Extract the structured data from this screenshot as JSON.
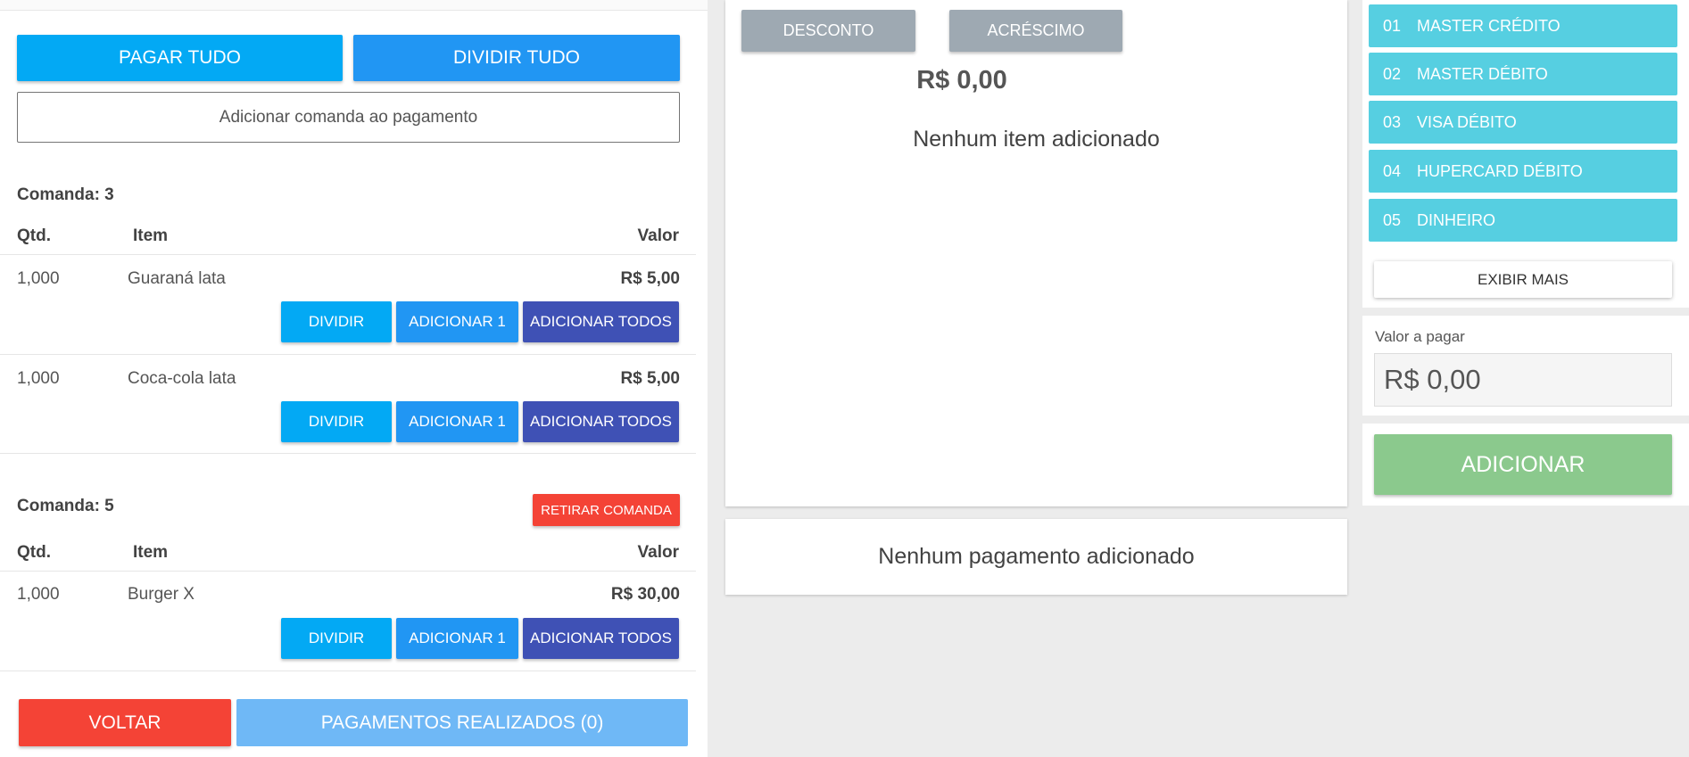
{
  "left": {
    "pay_all": "PAGAR TUDO",
    "split_all": "DIVIDIR TUDO",
    "add_comanda": "Adicionar comanda ao pagamento",
    "comandas": [
      {
        "title": "Comanda: 3",
        "headers": {
          "qty": "Qtd.",
          "item": "Item",
          "value": "Valor"
        },
        "rows": [
          {
            "qty": "1,000",
            "item": "Guaraná lata",
            "value": "R$ 5,00"
          },
          {
            "qty": "1,000",
            "item": "Coca-cola lata",
            "value": "R$ 5,00"
          }
        ]
      },
      {
        "title": "Comanda: 5",
        "remove_label": "RETIRAR COMANDA",
        "headers": {
          "qty": "Qtd.",
          "item": "Item",
          "value": "Valor"
        },
        "rows": [
          {
            "qty": "1,000",
            "item": "Burger X",
            "value": "R$ 30,00"
          }
        ]
      }
    ],
    "row_actions": {
      "split": "DIVIDIR",
      "add_one": "ADICIONAR 1",
      "add_all": "ADICIONAR TODOS"
    },
    "back": "VOLTAR",
    "payments_done": "PAGAMENTOS REALIZADOS (0)"
  },
  "middle": {
    "discount": "DESCONTO",
    "surcharge": "ACRÉSCIMO",
    "total": "R$ 0,00",
    "no_items": "Nenhum item adicionado",
    "no_payments": "Nenhum pagamento adicionado"
  },
  "right": {
    "methods": [
      {
        "num": "01",
        "label": "MASTER CRÉDITO"
      },
      {
        "num": "02",
        "label": "MASTER DÉBITO"
      },
      {
        "num": "03",
        "label": "VISA DÉBITO"
      },
      {
        "num": "04",
        "label": "HUPERCARD DÉBITO"
      },
      {
        "num": "05",
        "label": "DINHEIRO"
      }
    ],
    "show_more": "EXIBIR MAIS",
    "amount_label": "Valor a pagar",
    "amount_value": "R$ 0,00",
    "add": "ADICIONAR"
  },
  "colors": {
    "light_blue": "#03a9f4",
    "blue": "#2196f3",
    "indigo": "#3f51b5",
    "red": "#f44336",
    "cyan": "#56cfe1",
    "grey": "#9ea9b2",
    "green": "#8bc98d"
  }
}
